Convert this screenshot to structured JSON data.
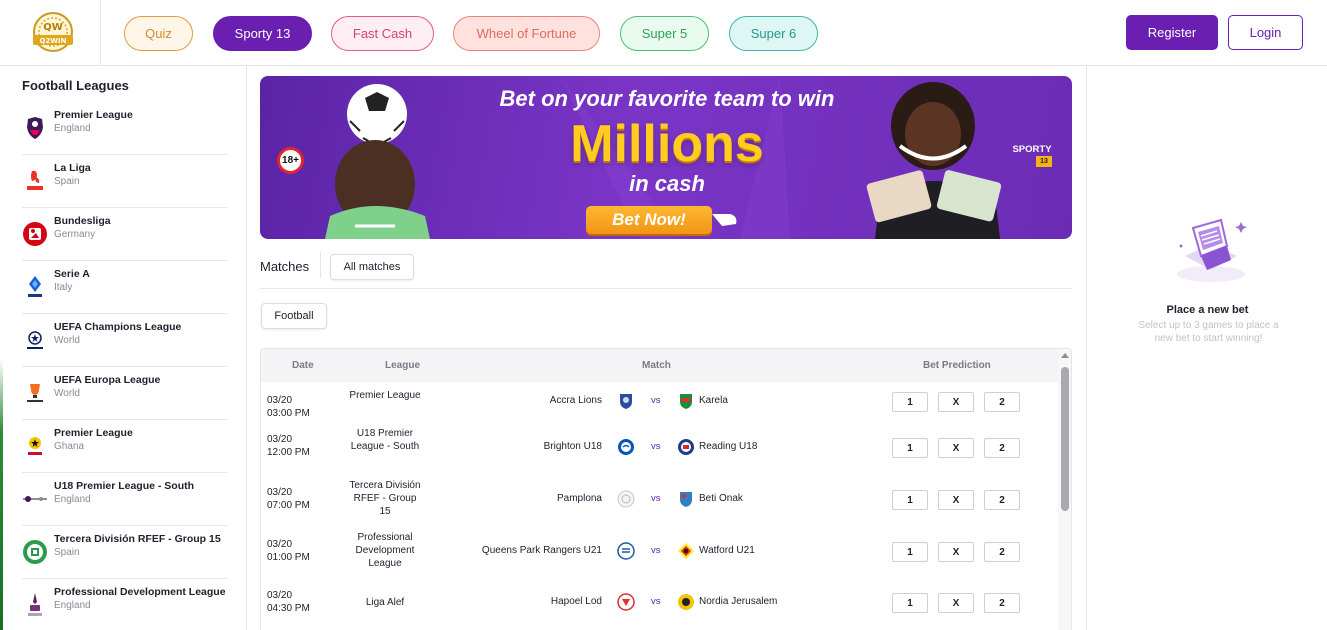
{
  "brand": {
    "logo_text": "Q2WIN",
    "logo_badge": "QW"
  },
  "nav": {
    "tabs": [
      {
        "label": "Quiz"
      },
      {
        "label": "Sporty 13"
      },
      {
        "label": "Fast Cash"
      },
      {
        "label": "Wheel of Fortune"
      },
      {
        "label": "Super 5"
      },
      {
        "label": "Super 6"
      }
    ],
    "active_tab": "Sporty 13",
    "register_label": "Register",
    "login_label": "Login"
  },
  "sidebar": {
    "title": "Football Leagues",
    "items": [
      {
        "name": "Premier League",
        "country": "England",
        "icon": "premier-league-lion-icon"
      },
      {
        "name": "La Liga",
        "country": "Spain",
        "icon": "laliga-icon"
      },
      {
        "name": "Bundesliga",
        "country": "Germany",
        "icon": "bundesliga-icon"
      },
      {
        "name": "Serie A",
        "country": "Italy",
        "icon": "serie-a-icon"
      },
      {
        "name": "UEFA Champions League",
        "country": "World",
        "icon": "champions-league-icon"
      },
      {
        "name": "UEFA Europa League",
        "country": "World",
        "icon": "europa-league-icon"
      },
      {
        "name": "Premier League",
        "country": "Ghana",
        "icon": "ghana-premier-league-icon"
      },
      {
        "name": "U18 Premier League - South",
        "country": "England",
        "icon": "u18-premier-league-icon"
      },
      {
        "name": "Tercera División RFEF - Group 15",
        "country": "Spain",
        "icon": "rfef-icon"
      },
      {
        "name": "Professional Development League",
        "country": "England",
        "icon": "pdl-icon"
      }
    ]
  },
  "banner": {
    "headline": "Bet on your favorite team to win",
    "highlight": "Millions",
    "subline": "in cash",
    "cta": "Bet Now!",
    "age_badge": "18+",
    "product_badge": "SPORTY",
    "product_badge_num": "13"
  },
  "matches": {
    "label": "Matches",
    "filter": "All matches",
    "sport": "Football",
    "columns": {
      "date": "Date",
      "league": "League",
      "match": "Match",
      "prediction": "Bet Prediction"
    },
    "vs_label": "vs",
    "picks": [
      "1",
      "X",
      "2"
    ],
    "rows": [
      {
        "date": "03/20",
        "time": "03:00 PM",
        "league": "Premier League",
        "home": "Accra Lions",
        "away": "Karela"
      },
      {
        "date": "03/20",
        "time": "12:00 PM",
        "league": "U18 Premier League - South",
        "home": "Brighton U18",
        "away": "Reading U18"
      },
      {
        "date": "03/20",
        "time": "07:00 PM",
        "league": "Tercera División RFEF - Group 15",
        "home": "Pamplona",
        "away": "Beti Onak"
      },
      {
        "date": "03/20",
        "time": "01:00 PM",
        "league": "Professional Development League",
        "home": "Queens Park Rangers U21",
        "away": "Watford U21"
      },
      {
        "date": "03/20",
        "time": "04:30 PM",
        "league": "Liga Alef",
        "home": "Hapoel Lod",
        "away": "Nordia Jerusalem"
      }
    ]
  },
  "betslip": {
    "title": "Place a new bet",
    "subtitle": "Select up to 3 games to place a new bet to start winning!",
    "icon": "ticket-machine-icon"
  },
  "colors": {
    "brand_purple": "#6a1fb0",
    "vs_purple": "#6a1fb0",
    "banner_gold": "#ffcc1f"
  }
}
